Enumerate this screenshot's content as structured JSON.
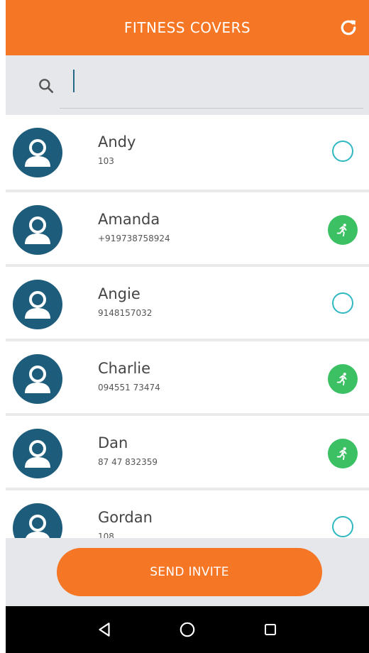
{
  "header": {
    "title": "FITNESS COVERS"
  },
  "search": {
    "placeholder": "",
    "value": ""
  },
  "contacts": [
    {
      "name": "Andy",
      "phone": "103",
      "status": "not-invited"
    },
    {
      "name": "Amanda",
      "phone": "+919738758924",
      "status": "active"
    },
    {
      "name": "Angie",
      "phone": "9148157032",
      "status": "not-invited"
    },
    {
      "name": "Charlie",
      "phone": "094551 73474",
      "status": "active"
    },
    {
      "name": "Dan",
      "phone": "87 47 832359",
      "status": "active"
    },
    {
      "name": "Gordan",
      "phone": "108",
      "status": "not-invited"
    }
  ],
  "footer": {
    "invite_label": "SEND INVITE"
  },
  "colors": {
    "accent": "#f57726",
    "avatar_bg": "#1d5c7a",
    "active_green": "#3bc063",
    "ring_teal": "#30b8c1"
  },
  "icons": {
    "refresh": "refresh-icon",
    "search": "search-icon",
    "avatar": "person-icon",
    "active": "running-icon",
    "back": "back-triangle-icon",
    "home": "home-circle-icon",
    "recents": "recents-square-icon"
  }
}
